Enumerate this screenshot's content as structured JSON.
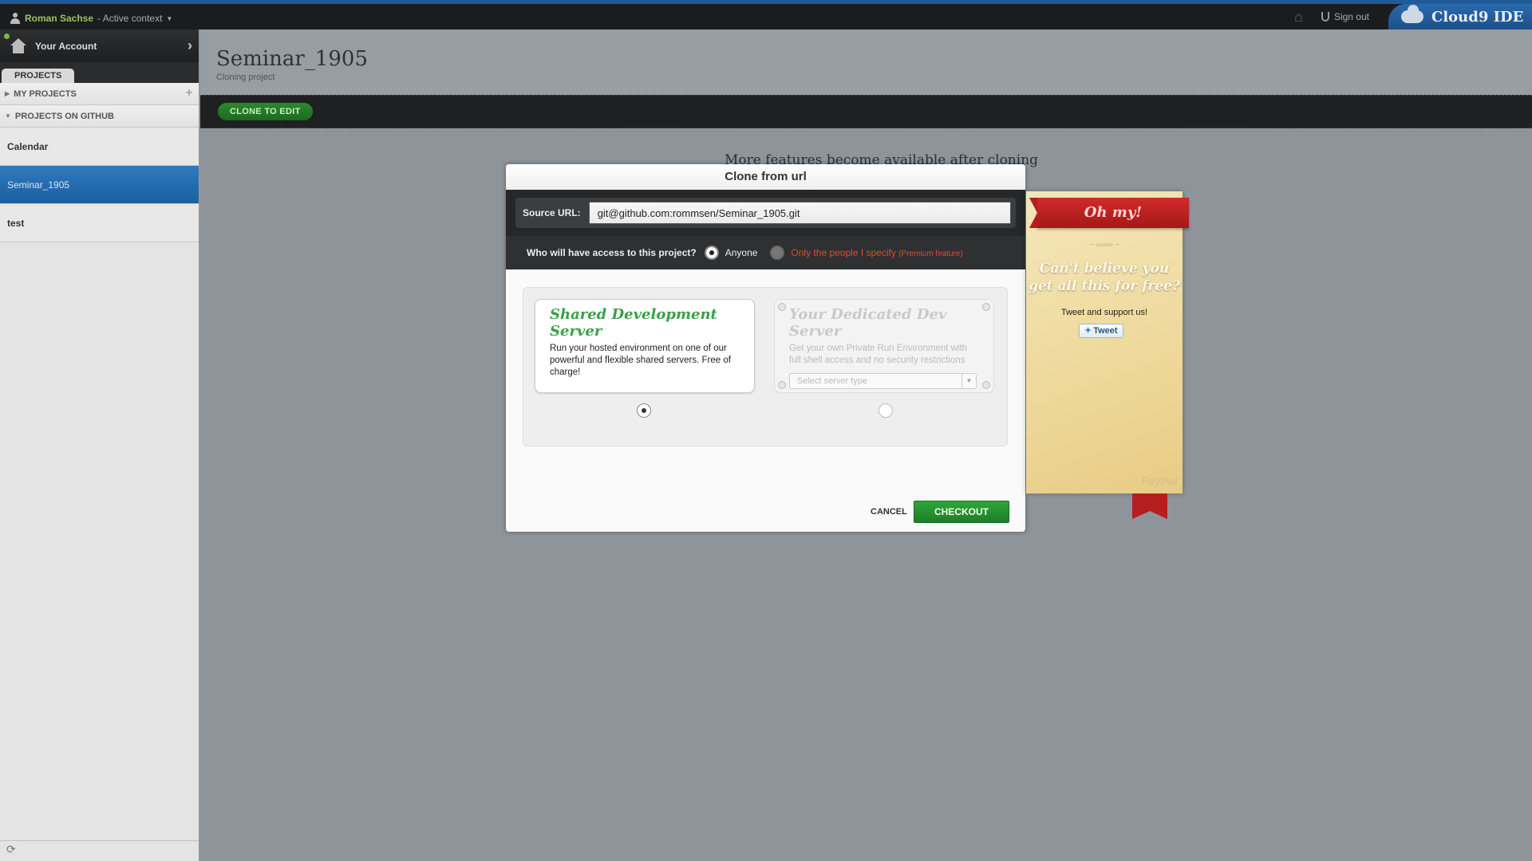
{
  "topbar": {
    "user_name": "Roman Sachse",
    "context": " - Active context",
    "sign_out": "Sign out",
    "brand": "Cloud9 IDE"
  },
  "sidebar": {
    "account_label": "Your Account",
    "tab_projects": "PROJECTS",
    "my_projects": "MY PROJECTS",
    "projects_on_github": "PROJECTS ON GITHUB",
    "projects": [
      {
        "label": "Calendar"
      },
      {
        "label": "Seminar_1905"
      },
      {
        "label": "test"
      }
    ]
  },
  "main": {
    "title": "Seminar_1905",
    "subtitle": "Cloning project",
    "clone_button": "CLONE TO EDIT",
    "features_text": "More features become available after cloning"
  },
  "modal": {
    "title": "Clone from url",
    "source_label": "Source URL:",
    "source_value": "git@github.com:rommsen/Seminar_1905.git",
    "access_question": "Who will have access to this project?",
    "access_anyone": "Anyone",
    "access_specify": "Only the people I specify",
    "access_premium": "(Premium feature)",
    "shared": {
      "title": "Shared Development Server",
      "desc": "Run your hosted environment on one of our powerful and flexible shared servers. Free of charge!"
    },
    "dedicated": {
      "title": "Your Dedicated Dev Server",
      "desc": "Get your own Private Run Environment with full shell access and no security restrictions",
      "select_placeholder": "Select server type"
    },
    "cancel": "CANCEL",
    "checkout": "CHECKOUT"
  },
  "promo": {
    "ribbon": "Oh my!",
    "headline_1": "Can't believe you",
    "headline_2": "get all this for free?",
    "sub": "Tweet and support us!",
    "tweet": "Tweet",
    "paypal": "PayPal"
  }
}
